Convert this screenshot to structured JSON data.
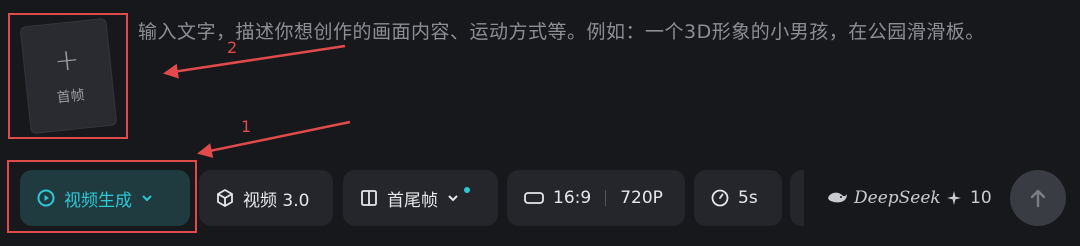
{
  "first_frame": {
    "plus": "+",
    "label": "首帧"
  },
  "prompt": {
    "placeholder": "输入文字，描述你想创作的画面内容、运动方式等。例如：一个3D形象的小男孩，在公园滑滑板。"
  },
  "annotations": {
    "one": "1",
    "two": "2",
    "color": "#e14a4a"
  },
  "toolbar": {
    "mode_label": "视频生成",
    "model_label": "视频 3.0",
    "frames_label": "首尾帧",
    "ratio_label": "16:9",
    "resolution_label": "720P",
    "duration_label": "5s",
    "deepseek_label": "DeepSeek",
    "credits": "10"
  },
  "colors": {
    "accent": "#2ec7d6",
    "background": "#17181c",
    "chip": "#24262b"
  },
  "icons": [
    "play-circle-icon",
    "chevron-down-icon",
    "cube-icon",
    "frames-icon",
    "aspect-ratio-icon",
    "clock-icon",
    "deepseek-whale-icon",
    "sparkle-icon",
    "arrow-up-icon"
  ]
}
